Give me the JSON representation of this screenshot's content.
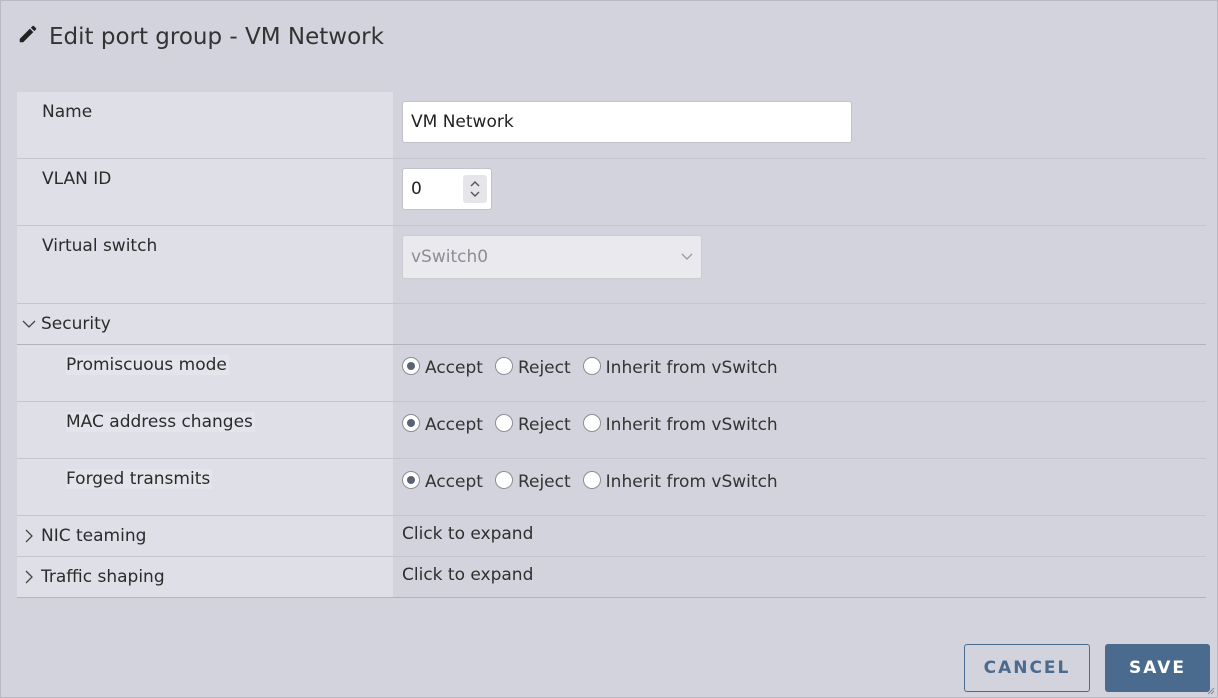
{
  "dialog": {
    "title": "Edit port group - VM Network",
    "title_icon": "pencil-icon"
  },
  "form": {
    "name": {
      "label": "Name",
      "value": "VM Network"
    },
    "vlan": {
      "label": "VLAN ID",
      "value": "0"
    },
    "vswitch": {
      "label": "Virtual switch",
      "value": "vSwitch0"
    },
    "security": {
      "label": "Security",
      "expanded": true,
      "options": [
        "Accept",
        "Reject",
        "Inherit from vSwitch"
      ],
      "rows": [
        {
          "label": "Promiscuous mode",
          "selected": "Accept"
        },
        {
          "label": "MAC address changes",
          "selected": "Accept"
        },
        {
          "label": "Forged transmits",
          "selected": "Accept"
        }
      ]
    },
    "nic_teaming": {
      "label": "NIC teaming",
      "hint": "Click to expand"
    },
    "traffic_shaping": {
      "label": "Traffic shaping",
      "hint": "Click to expand"
    }
  },
  "buttons": {
    "cancel": "CANCEL",
    "save": "SAVE"
  },
  "colors": {
    "primary": "#4a6a8e",
    "background": "#d3d3dd",
    "label_bg": "#dfdfe8"
  }
}
